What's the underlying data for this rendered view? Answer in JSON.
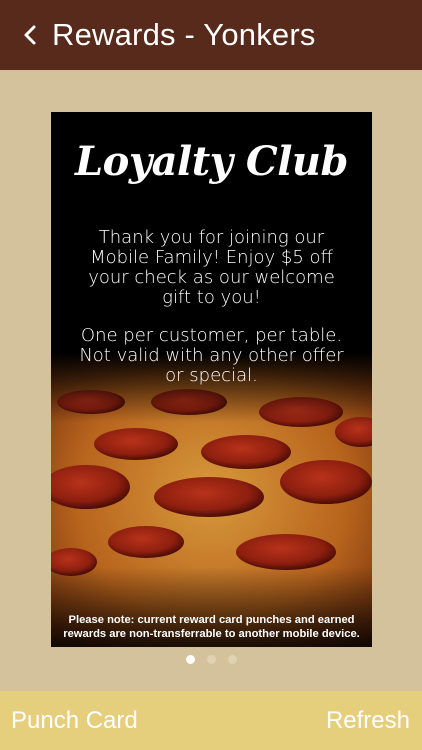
{
  "header": {
    "back_icon": "chevron-left-icon",
    "title": "Rewards - Yonkers"
  },
  "card": {
    "title": "Loyalty Club",
    "message_line1": "Thank you for joining our Mobile Family! Enjoy $5 off your check as our welcome gift to you!",
    "message_line2": "One per customer, per table. Not valid with any other offer or special.",
    "note": "Please note: current reward card punches and earned rewards are non-transferrable to another mobile device.",
    "background": "pepperoni-pizza-image"
  },
  "pager": {
    "total": 3,
    "active_index": 0
  },
  "footer": {
    "left_label": "Punch Card",
    "right_label": "Refresh"
  },
  "colors": {
    "header_bg": "#582a1c",
    "page_bg": "#d3c29b",
    "footer_bg": "#e6cf7c"
  }
}
